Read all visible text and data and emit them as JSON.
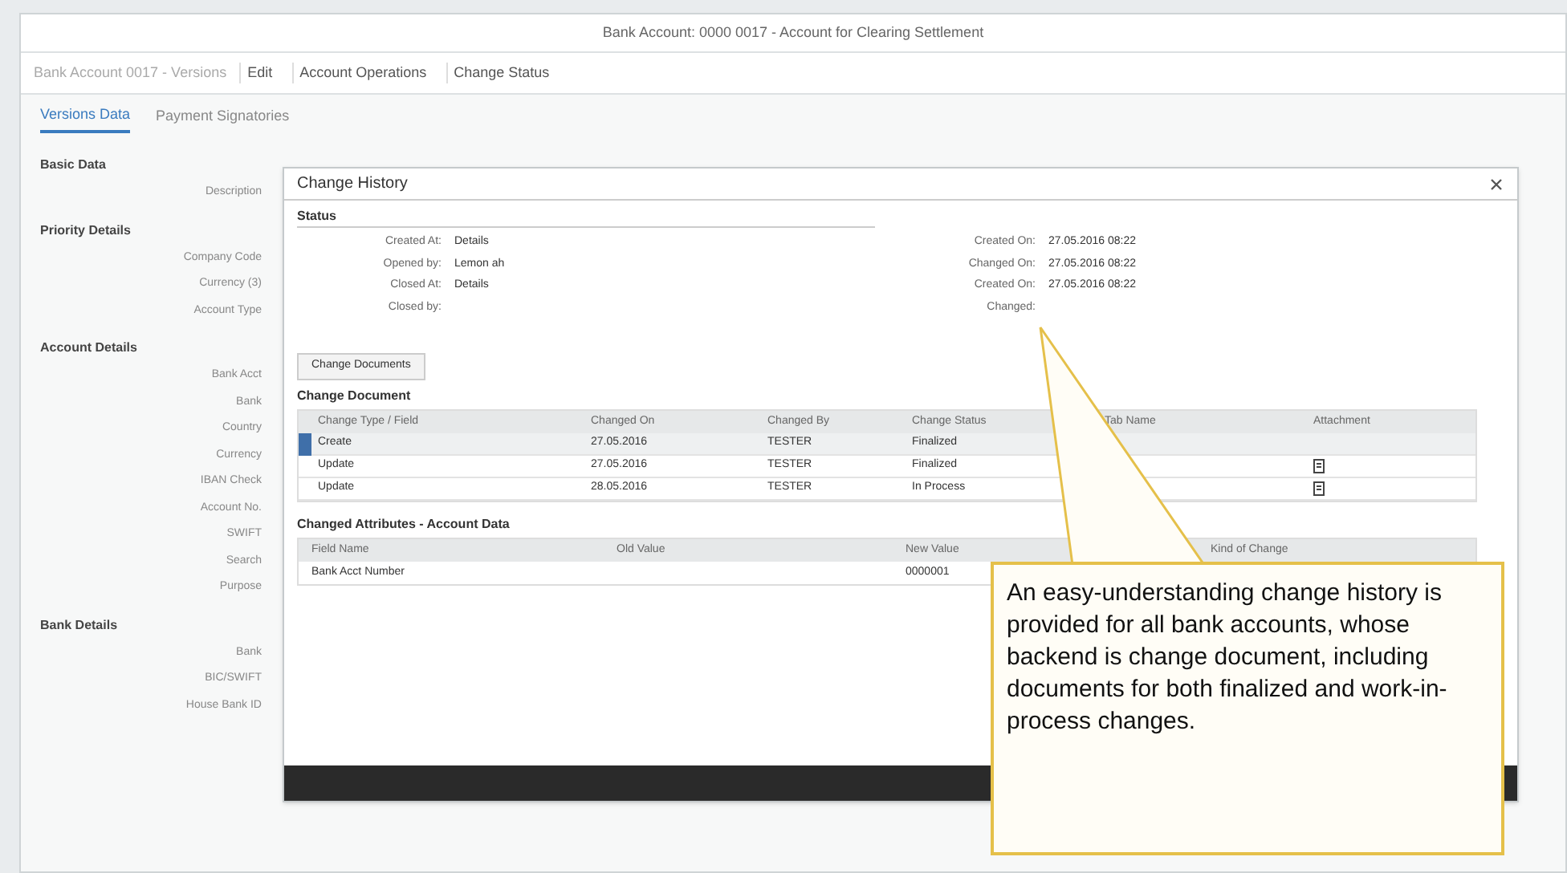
{
  "window": {
    "title": "Bank Account: 0000 0017 - Account for Clearing Settlement"
  },
  "toolbar": {
    "breadcrumb": "Bank Account 0017 - Versions",
    "buttons": [
      "Edit",
      "Account Operations",
      "Change Status"
    ]
  },
  "tabs": [
    {
      "label": "Versions Data",
      "selected": true
    },
    {
      "label": "Payment Signatories",
      "selected": false
    }
  ],
  "sidebar": {
    "sections": [
      {
        "title": "Basic Data",
        "labels": [
          "Description"
        ]
      },
      {
        "title": "Priority Details",
        "labels": [
          "Company Code",
          "Currency (3)",
          "Account Type"
        ]
      },
      {
        "title": "Account Details",
        "labels": [
          "Bank Acct",
          "Bank",
          "Country",
          "Currency",
          "IBAN Check",
          "Account No.",
          "SWIFT",
          "Search",
          "Purpose"
        ]
      },
      {
        "title": "Bank Details",
        "labels": [
          "Bank",
          "BIC/SWIFT",
          "House Bank ID"
        ]
      }
    ]
  },
  "dialog": {
    "title": "Change History",
    "status": {
      "title": "Status",
      "left": [
        {
          "label": "Created At:",
          "value": "Details"
        },
        {
          "label": "Opened by:",
          "value": "Lemon ah"
        },
        {
          "label": "Closed At:",
          "value": "Details"
        },
        {
          "label": "Closed by:"
        }
      ],
      "right": [
        {
          "label": "Created On:",
          "value": "27.05.2016 08:22"
        },
        {
          "label": "Changed On:",
          "value": "27.05.2016 08:22"
        },
        {
          "label": "Created On:",
          "value": "27.05.2016 08:22"
        },
        {
          "label": "Changed:"
        }
      ]
    },
    "section_tab": "Change Documents",
    "changes": {
      "title": "Change Document",
      "columns": [
        "Change Type / Field",
        "Changed On",
        "Changed By",
        "Change Status",
        "Tab Name",
        "Attachment"
      ],
      "rows": [
        {
          "selected": true,
          "cells": [
            "Create",
            "27.05.2016",
            "TESTER",
            "Finalized",
            "",
            ""
          ],
          "attachment": false
        },
        {
          "selected": false,
          "cells": [
            "Update",
            "27.05.2016",
            "TESTER",
            "Finalized",
            "",
            ""
          ],
          "attachment": true
        },
        {
          "selected": false,
          "cells": [
            "Update",
            "28.05.2016",
            "TESTER",
            "In Process",
            "",
            ""
          ],
          "attachment": true
        }
      ]
    },
    "attributes": {
      "title": "Changed Attributes - Account Data",
      "columns": [
        "Field Name",
        "Old Value",
        "New Value",
        "Kind of Change"
      ],
      "rows": [
        [
          "Bank Acct Number",
          "",
          "0000001"
        ]
      ]
    }
  },
  "callout": "An easy-understanding change history is provided for all bank accounts, whose backend is change document, including documents for both finalized and work-in-process changes."
}
